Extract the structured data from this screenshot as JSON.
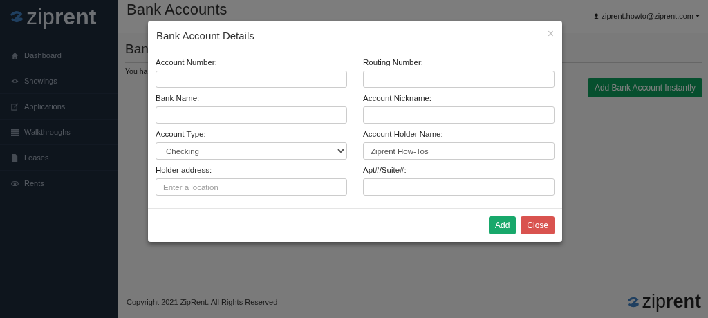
{
  "sidebar": {
    "logo": "zip**rent**",
    "items": [
      {
        "label": "Dashboard"
      },
      {
        "label": "Showings"
      },
      {
        "label": "Applications"
      },
      {
        "label": "Walkthroughs"
      },
      {
        "label": "Leases"
      },
      {
        "label": "Rents"
      }
    ]
  },
  "header": {
    "title": "Bank Accounts",
    "user": "ziprent.howto@ziprent.com"
  },
  "content": {
    "heading": "Ban",
    "text": "You ha",
    "action_button": "Add Bank Account Instantly"
  },
  "footer": {
    "copyright": "Copyright 2021 ZipRent. All Rights Reserved",
    "logo": "zip**rent**"
  },
  "modal": {
    "title": "Bank Account Details",
    "close": "×",
    "fields": [
      {
        "kind": "text",
        "label": "Account Number:"
      },
      {
        "kind": "text",
        "label": "Routing Number:"
      },
      {
        "kind": "text",
        "label": "Bank Name:"
      },
      {
        "kind": "text",
        "label": "Account Nickname:"
      },
      {
        "kind": "select",
        "label": "Account Type:",
        "value": "Checking"
      },
      {
        "kind": "text",
        "label": "Account Holder Name:",
        "value": "Ziprent How-Tos"
      },
      {
        "kind": "text",
        "label": "Holder address:",
        "placeholder": "Enter a location"
      },
      {
        "kind": "text",
        "label": "Apt#/Suite#:"
      }
    ],
    "buttons": [
      {
        "label": "Add",
        "kind": "primary"
      },
      {
        "label": "Close",
        "kind": "danger"
      }
    ]
  }
}
